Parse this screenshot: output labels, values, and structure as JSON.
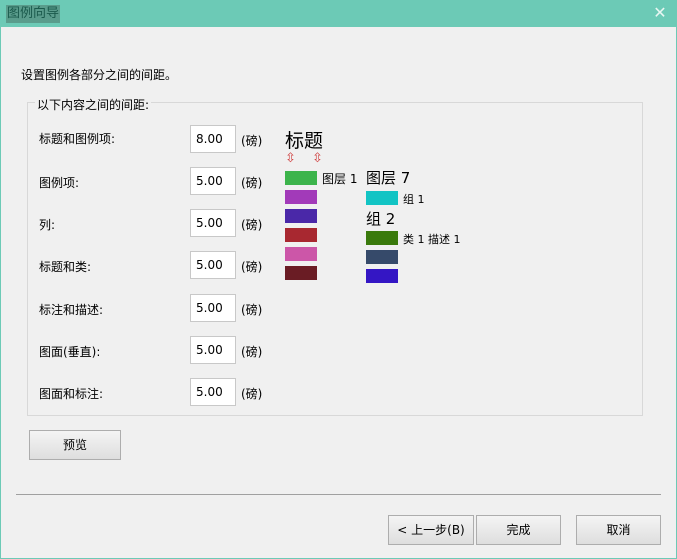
{
  "window": {
    "title": "图例向导",
    "close_glyph": "✕"
  },
  "instruction": "设置图例各部分之间的间距。",
  "group": {
    "legend": "以下内容之间的间距:",
    "rows": [
      {
        "label": "标题和图例项:",
        "value": "8.00",
        "unit": "(磅)"
      },
      {
        "label": "图例项:",
        "value": "5.00",
        "unit": "(磅)"
      },
      {
        "label": "列:",
        "value": "5.00",
        "unit": "(磅)"
      },
      {
        "label": "标题和类:",
        "value": "5.00",
        "unit": "(磅)"
      },
      {
        "label": "标注和描述:",
        "value": "5.00",
        "unit": "(磅)"
      },
      {
        "label": "图面(垂直):",
        "value": "5.00",
        "unit": "(磅)"
      },
      {
        "label": "图面和标注:",
        "value": "5.00",
        "unit": "(磅)"
      }
    ]
  },
  "preview": {
    "title": "标题",
    "arrow_glyph": "⇳",
    "col1": {
      "layer_label": "图层 1",
      "swatch_colors": [
        "#3cb44b",
        "#a23ab9",
        "#4a28a8",
        "#a82830",
        "#cc56a8",
        "#6a1c24"
      ]
    },
    "col2": {
      "layer_head": "图层 7",
      "group1_label": "组 1",
      "group1_color": "#12c4c4",
      "group2_head": "组 2",
      "group2_item_label": "类 1 描述 1",
      "group2_colors": [
        "#3a7a0c",
        "#364a6a",
        "#3416c4"
      ]
    }
  },
  "buttons": {
    "preview": "预览",
    "back": "< 上一步(B)",
    "finish": "完成",
    "cancel": "取消"
  }
}
